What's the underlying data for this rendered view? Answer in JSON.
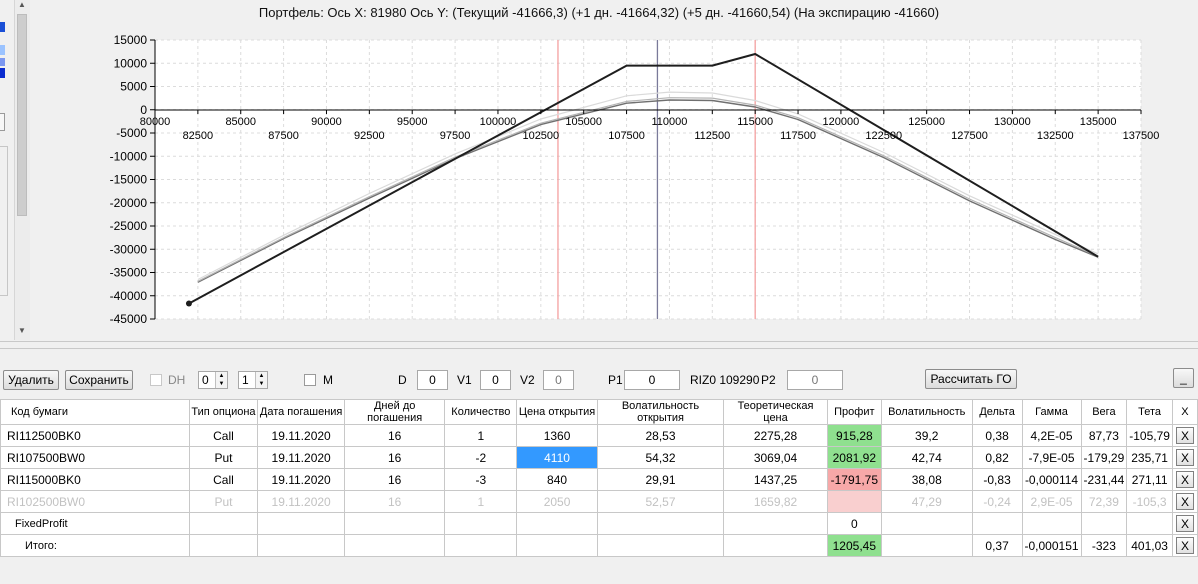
{
  "chart_data": {
    "type": "line",
    "title": "Портфель: Ось X: 81980 Ось Y:  (Текущий -41666,3)  (+1 дн. -41664,32)  (+5 дн. -41660,54)  (На экспирацию -41660)",
    "xlim": [
      80000,
      137500
    ],
    "ylim": [
      -45000,
      15000
    ],
    "x_ticks_upper": [
      80000,
      85000,
      90000,
      95000,
      100000,
      105000,
      110000,
      115000,
      120000,
      125000,
      130000,
      135000
    ],
    "x_ticks_lower": [
      82500,
      87500,
      92500,
      97500,
      102500,
      107500,
      112500,
      117500,
      122500,
      127500,
      132500,
      137500
    ],
    "y_ticks": [
      15000,
      10000,
      5000,
      0,
      -5000,
      -10000,
      -15000,
      -20000,
      -25000,
      -30000,
      -35000,
      -40000,
      -45000
    ],
    "grid": true,
    "vertical_markers": [
      {
        "x": 103500,
        "color": "#f4a0a0"
      },
      {
        "x": 109300,
        "color": "#7a7a9a"
      },
      {
        "x": 115000,
        "color": "#f4a0a0"
      }
    ],
    "series": [
      {
        "color": "#1e1e1e",
        "width": 2,
        "x": [
          81980,
          107500,
          112500,
          115000,
          135000
        ],
        "y": [
          -41660,
          9500,
          9500,
          12000,
          -31600
        ]
      },
      {
        "color": "#dadada",
        "width": 1.2,
        "x": [
          82500,
          87500,
          92500,
          97500,
          102500,
          107500,
          110000,
          112500,
          115000,
          117500,
          122500,
          127500,
          132500,
          135000
        ],
        "y": [
          -36500,
          -27000,
          -18000,
          -9500,
          -2000,
          3000,
          3800,
          3600,
          2000,
          -900,
          -9200,
          -18500,
          -26800,
          -31000
        ]
      },
      {
        "color": "#b4b4b4",
        "width": 1.2,
        "x": [
          82500,
          87500,
          92500,
          97500,
          102500,
          107500,
          110000,
          112500,
          115000,
          117500,
          122500,
          127500,
          132500,
          135000
        ],
        "y": [
          -36900,
          -27500,
          -18700,
          -10200,
          -2900,
          1800,
          2600,
          2500,
          1000,
          -1700,
          -9900,
          -19200,
          -27500,
          -31500
        ]
      },
      {
        "color": "#707070",
        "width": 1.4,
        "x": [
          82500,
          87500,
          92500,
          97500,
          102500,
          107500,
          110000,
          112500,
          115000,
          117500,
          122500,
          127500,
          132500,
          135000
        ],
        "y": [
          -37100,
          -27700,
          -19000,
          -10500,
          -3200,
          1400,
          2100,
          2000,
          600,
          -2100,
          -10300,
          -19600,
          -27900,
          -31700
        ]
      }
    ],
    "end_point": {
      "x": 81980,
      "y": -41660
    }
  },
  "toolbar": {
    "delete_label": "Удалить",
    "save_label": "Сохранить",
    "dh_label": "DH",
    "spin1_value": "0",
    "spin2_value": "1",
    "m_label": "M",
    "d_label": "D",
    "d_value": "0",
    "v1_label": "V1",
    "v1_value": "0",
    "v2_label": "V2",
    "v2_value": "0",
    "p1_label": "P1",
    "p1_value": "0",
    "riz_label": "RIZ0 109290",
    "p2_label": "P2",
    "p2_value": "0",
    "calc_label": "Рассчитать ГО",
    "minimize_label": "_"
  },
  "table": {
    "headers": [
      "Код бумаги",
      "Тип опциона",
      "Дата погашения",
      "Дней до погашения",
      "Количество",
      "Цена открытия",
      "Волатильность открытия",
      "Теоретическая цена",
      "Профит",
      "Волатильность",
      "Дельта",
      "Гамма",
      "Вега",
      "Тета",
      "X"
    ],
    "rows": [
      {
        "cells": [
          "RI112500BK0",
          "Call",
          "19.11.2020",
          "16",
          "1",
          "1360",
          "28,53",
          "2275,28",
          "915,28",
          "39,2",
          "0,38",
          "4,2E-05",
          "87,73",
          "-105,79"
        ]
      },
      {
        "cells": [
          "RI107500BW0",
          "Put",
          "19.11.2020",
          "16",
          "-2",
          "4110",
          "54,32",
          "3069,04",
          "2081,92",
          "42,74",
          "0,82",
          "-7,9E-05",
          "-179,29",
          "235,71"
        ]
      },
      {
        "cells": [
          "RI115000BK0",
          "Call",
          "19.11.2020",
          "16",
          "-3",
          "840",
          "29,91",
          "1437,25",
          "-1791,75",
          "38,08",
          "-0,83",
          "-0,000114",
          "-231,44",
          "271,11"
        ]
      },
      {
        "cells": [
          "RI102500BW0",
          "Put",
          "19.11.2020",
          "16",
          "1",
          "2050",
          "52,57",
          "1659,82",
          "",
          "47,29",
          "-0,24",
          "2,9E-05",
          "72,39",
          "-105,3"
        ]
      }
    ],
    "fixed_profit_label": "FixedProfit",
    "fixed_profit_value": "0",
    "total_label": "Итого:",
    "total_profit": "1205,45",
    "total_delta": "0,37",
    "total_gamma": "-0,000151",
    "total_vega": "-323",
    "total_theta": "401,03",
    "x_label": "X"
  }
}
